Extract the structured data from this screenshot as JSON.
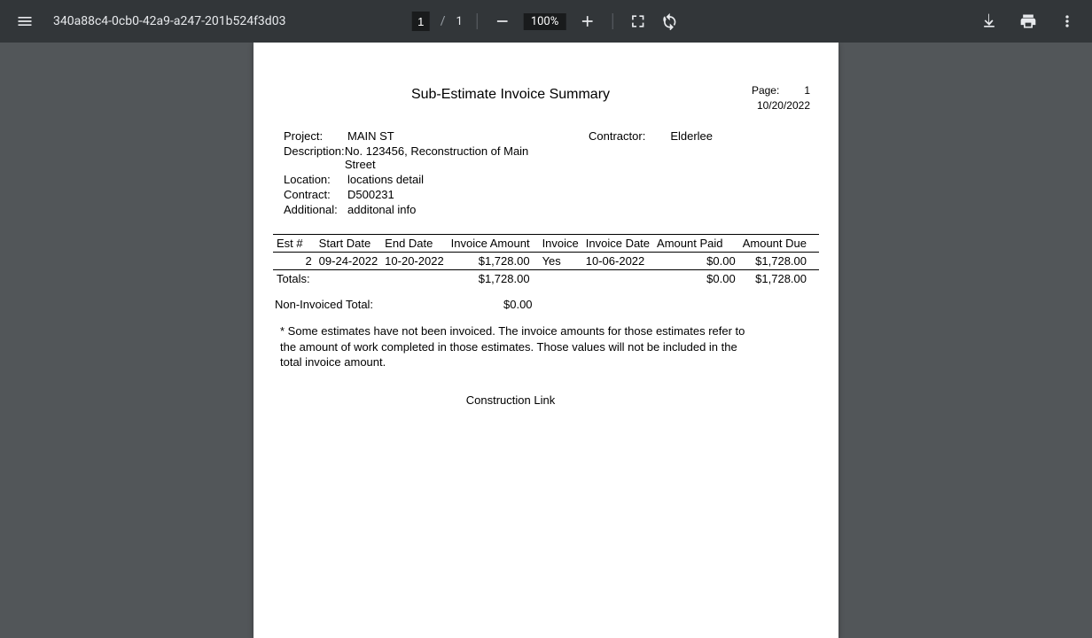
{
  "toolbar": {
    "filename": "340a88c4-0cb0-42a9-a247-201b524f3d03",
    "page_current": "1",
    "page_separator": "/",
    "page_total": "1",
    "zoom": "100%"
  },
  "doc": {
    "title": "Sub-Estimate Invoice Summary",
    "page_label": "Page:",
    "page_num": "1",
    "date": "10/20/2022",
    "info": {
      "project_label": "Project:",
      "project": "MAIN  ST",
      "description_label": "Description:",
      "description": "No. 123456, Reconstruction of Main Street",
      "location_label": "Location:",
      "location": "locations detail",
      "contract_label": "Contract:",
      "contract": "D500231",
      "additional_label": "Additional:",
      "additional": "additonal info",
      "contractor_label": "Contractor:",
      "contractor": "Elderlee"
    },
    "table": {
      "headers": {
        "est": "Est #",
        "start": "Start Date",
        "end": "End Date",
        "invoice_amount": "Invoice Amount",
        "invoice": "Invoice",
        "invoice_date": "Invoice Date",
        "amount_paid": "Amount Paid",
        "amount_due": "Amount Due"
      },
      "row": {
        "est": "2",
        "start": "09-24-2022",
        "end": "10-20-2022",
        "invoice_amount": "$1,728.00",
        "invoice": "Yes",
        "invoice_date": "10-06-2022",
        "amount_paid": "$0.00",
        "amount_due": "$1,728.00"
      },
      "totals_label": "Totals:",
      "totals": {
        "invoice_amount": "$1,728.00",
        "amount_paid": "$0.00",
        "amount_due": "$1,728.00"
      }
    },
    "noninvoiced_label": "Non-Invoiced Total:",
    "noninvoiced_value": "$0.00",
    "footnote": "*  Some estimates have not been invoiced.  The invoice amounts for those estimates refer to the amount of work completed in those estimates.  Those values will not be included in the total invoice amount.",
    "footer": "Construction Link"
  }
}
